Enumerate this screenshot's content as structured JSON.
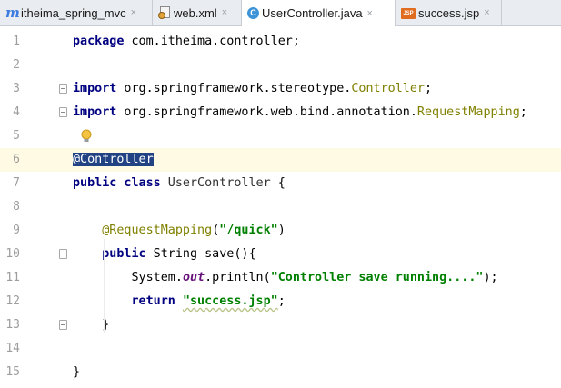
{
  "tabs": [
    {
      "label": "itheima_spring_mvc",
      "icon": "module-icon",
      "active": false
    },
    {
      "label": "web.xml",
      "icon": "xml-file-icon",
      "active": false
    },
    {
      "label": "UserController.java",
      "icon": "java-class-icon",
      "active": true
    },
    {
      "label": "success.jsp",
      "icon": "jsp-file-icon",
      "active": false
    }
  ],
  "tab_close_glyph": "×",
  "icon_glyphs": {
    "module": "m",
    "java_class": "C",
    "jsp": "JSP"
  },
  "editor": {
    "current_line": 6,
    "lines": [
      {
        "n": "1",
        "parts": [
          {
            "t": "package",
            "c": "kw"
          },
          {
            "t": " com.itheima.controller;",
            "c": ""
          }
        ]
      },
      {
        "n": "2",
        "parts": []
      },
      {
        "n": "3",
        "parts": [
          {
            "t": "import",
            "c": "kw"
          },
          {
            "t": " org.springframework.stereotype.",
            "c": ""
          },
          {
            "t": "Controller",
            "c": "ann"
          },
          {
            "t": ";",
            "c": ""
          }
        ]
      },
      {
        "n": "4",
        "parts": [
          {
            "t": "import",
            "c": "kw"
          },
          {
            "t": " org.springframework.web.bind.annotation.",
            "c": ""
          },
          {
            "t": "RequestMapping",
            "c": "ann"
          },
          {
            "t": ";",
            "c": ""
          }
        ]
      },
      {
        "n": "5",
        "parts": []
      },
      {
        "n": "6",
        "parts": [
          {
            "t": "@Controller",
            "c": "ann sel"
          }
        ]
      },
      {
        "n": "7",
        "parts": [
          {
            "t": "public class",
            "c": "kw"
          },
          {
            "t": " UserController ",
            "c": "cls"
          },
          {
            "t": "{",
            "c": ""
          }
        ]
      },
      {
        "n": "8",
        "parts": []
      },
      {
        "n": "9",
        "parts": [
          {
            "t": "    @RequestMapping",
            "c": "ann"
          },
          {
            "t": "(",
            "c": ""
          },
          {
            "t": "\"/quick\"",
            "c": "str"
          },
          {
            "t": ")",
            "c": ""
          }
        ]
      },
      {
        "n": "10",
        "parts": [
          {
            "t": "    ",
            "c": ""
          },
          {
            "t": "public",
            "c": "kw"
          },
          {
            "t": " String save(){",
            "c": ""
          }
        ]
      },
      {
        "n": "11",
        "parts": [
          {
            "t": "        System.",
            "c": ""
          },
          {
            "t": "out",
            "c": "fld"
          },
          {
            "t": ".println(",
            "c": ""
          },
          {
            "t": "\"Controller save running....\"",
            "c": "str"
          },
          {
            "t": ");",
            "c": ""
          }
        ]
      },
      {
        "n": "12",
        "parts": [
          {
            "t": "        ",
            "c": ""
          },
          {
            "t": "return",
            "c": "kw"
          },
          {
            "t": " ",
            "c": ""
          },
          {
            "t": "\"success.jsp\"",
            "c": "str squiggle"
          },
          {
            "t": ";",
            "c": ""
          }
        ]
      },
      {
        "n": "13",
        "parts": [
          {
            "t": "    }",
            "c": ""
          }
        ]
      },
      {
        "n": "14",
        "parts": []
      },
      {
        "n": "15",
        "parts": [
          {
            "t": "}",
            "c": ""
          }
        ]
      }
    ],
    "fold_markers": [
      "3",
      "4",
      "10",
      "13"
    ]
  }
}
